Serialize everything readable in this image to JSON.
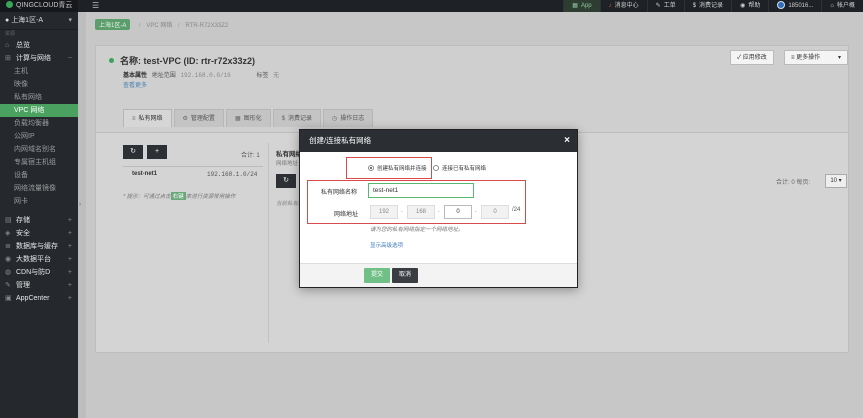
{
  "topbar": {
    "brand": "QINGCLOUD青云",
    "nav": [
      {
        "label": "App",
        "icon": "grid-icon"
      },
      {
        "label": "消息中心",
        "icon": "bell-icon"
      },
      {
        "label": "工单",
        "icon": "ticket-icon"
      },
      {
        "label": "消费记录",
        "icon": "wallet-icon"
      },
      {
        "label": "帮助",
        "icon": "help-icon"
      },
      {
        "label": "185016...",
        "icon": "avatar"
      },
      {
        "label": "帐户概",
        "icon": "home-icon"
      }
    ]
  },
  "sidebar": {
    "zone": "上海1区-A",
    "tag_top": "资源",
    "items": [
      {
        "label": "总览",
        "type": "head",
        "icon": "⌂"
      },
      {
        "label": "计算与网络",
        "type": "head",
        "icon": "⊞",
        "plus": "−"
      },
      {
        "label": "主机",
        "type": "sub"
      },
      {
        "label": "映像",
        "type": "sub"
      },
      {
        "label": "私有网络",
        "type": "sub"
      },
      {
        "label": "VPC 网络",
        "type": "sub",
        "active": true
      },
      {
        "label": "负载均衡器",
        "type": "sub"
      },
      {
        "label": "公网IP",
        "type": "sub"
      },
      {
        "label": "内网域名别名",
        "type": "sub"
      },
      {
        "label": "专属宿主机组",
        "type": "sub"
      },
      {
        "label": "设备",
        "type": "sub"
      },
      {
        "label": "网络流量镜像",
        "type": "sub"
      },
      {
        "label": "网卡",
        "type": "sub"
      }
    ],
    "groups": [
      {
        "label": "存储",
        "icon": "▤",
        "plus": "+"
      },
      {
        "label": "安全",
        "icon": "◈",
        "plus": "+"
      },
      {
        "label": "数据库与缓存",
        "icon": "≣",
        "plus": "+"
      },
      {
        "label": "大数据平台",
        "icon": "◉",
        "plus": "+"
      },
      {
        "label": "CDN与防D",
        "icon": "◍",
        "plus": "+"
      },
      {
        "label": "管理",
        "icon": "✎",
        "plus": "+"
      },
      {
        "label": "AppCenter",
        "icon": "▣",
        "plus": "+"
      }
    ]
  },
  "breadcrumb": {
    "zone": "上海1区-A",
    "level1": "VPC 网络",
    "level2": "RTR-R72X33Z2"
  },
  "vpc": {
    "title": "名称: test-VPC (ID: rtr-r72x33z2)",
    "type_label": "基本属性",
    "addr_label": "地址范围",
    "addr_value": "192.168.0.0/16",
    "tag_label": "标签",
    "tag_value": "无",
    "more": "查看更多",
    "apply_btn": "应用修改",
    "more_ops_btn": "更多操作",
    "tabs": [
      {
        "label": "私有网络",
        "icon": "≡"
      },
      {
        "label": "管理配置",
        "icon": "⚙"
      },
      {
        "label": "图形化",
        "icon": "▦"
      },
      {
        "label": "消费记录",
        "icon": "$"
      },
      {
        "label": "操作日志",
        "icon": "◷"
      }
    ]
  },
  "list": {
    "refresh": "↻",
    "add": "+",
    "count_left": "合计: 1",
    "router_name": "test-net1",
    "router_ip": "192.168.1.0/24",
    "hint_prefix": "* 提示：可通过点击",
    "hint_tag": "右键",
    "hint_suffix": "来进行资源常用操作",
    "right_title": "私有网络",
    "right_sub": "网络地址",
    "right_empty": "当前私有网...",
    "count_right": "合计: 0  每页:",
    "page_size": "10"
  },
  "modal": {
    "title": "创建/连接私有网络",
    "close": "×",
    "radio_create": "创建私有网络并连接",
    "radio_connect": "连接已有私有网络",
    "name_label": "私有网络名称",
    "name_value": "test-net1",
    "addr_label": "网络地址",
    "octets": [
      "192",
      "168",
      "0",
      "0"
    ],
    "mask": "/24",
    "addr_hint": "请为您的私有网络指定一个网络地址。",
    "advanced": "显示高级选项",
    "submit": "提交",
    "cancel": "取消"
  },
  "colors": {
    "accent_green": "#4aa160",
    "dark_header": "#2b2f34",
    "highlight_red": "#d94b4b"
  }
}
